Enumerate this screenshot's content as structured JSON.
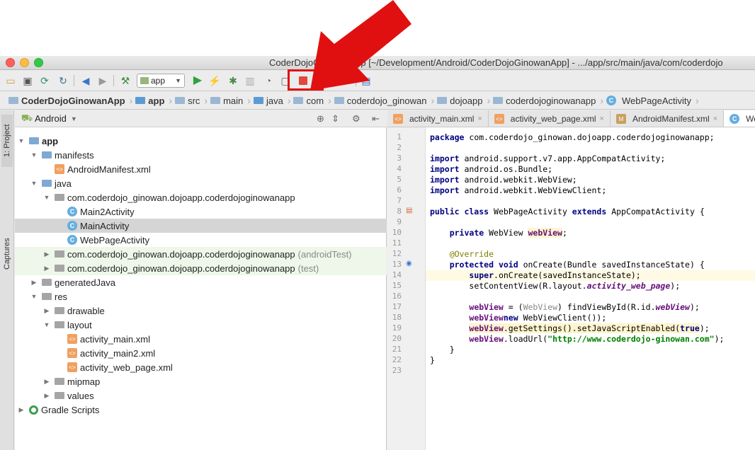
{
  "window": {
    "title": "CoderDojoGinowanApp [~/Development/Android/CoderDojoGinowanApp] - .../app/src/main/java/com/coderdojo"
  },
  "toolbar": {
    "run_config": "app",
    "icons": [
      "open-icon",
      "save-icon",
      "sync-icon",
      "refresh-icon",
      "back-icon",
      "forward-icon",
      "build-icon",
      "run-icon",
      "instant-run-icon",
      "debug-icon",
      "attach-icon",
      "profile-icon",
      "apply-icon",
      "stop-icon",
      "sdk-icon",
      "download-icon",
      "device-icon"
    ],
    "highlight_color": "#e01010"
  },
  "breadcrumb": [
    "CoderDojoGinowanApp",
    "app",
    "src",
    "main",
    "java",
    "com",
    "coderdojo_ginowan",
    "dojoapp",
    "coderdojoginowanapp",
    "WebPageActivity"
  ],
  "side_tabs": {
    "project": "1: Project",
    "captures": "Captures"
  },
  "project_panel": {
    "view_mode": "Android",
    "tree": [
      {
        "label": "app",
        "bold": true
      },
      {
        "label": "manifests"
      },
      {
        "label": "AndroidManifest.xml"
      },
      {
        "label": "java"
      },
      {
        "label": "com.coderdojo_ginowan.dojoapp.coderdojoginowanapp"
      },
      {
        "label": "Main2Activity"
      },
      {
        "label": "MainActivity"
      },
      {
        "label": "WebPageActivity"
      },
      {
        "label": "com.coderdojo_ginowan.dojoapp.coderdojoginowanapp",
        "suffix": "(androidTest)"
      },
      {
        "label": "com.coderdojo_ginowan.dojoapp.coderdojoginowanapp",
        "suffix": "(test)"
      },
      {
        "label": "generatedJava"
      },
      {
        "label": "res"
      },
      {
        "label": "drawable"
      },
      {
        "label": "layout"
      },
      {
        "label": "activity_main.xml"
      },
      {
        "label": "activity_main2.xml"
      },
      {
        "label": "activity_web_page.xml"
      },
      {
        "label": "mipmap"
      },
      {
        "label": "values"
      },
      {
        "label": "Gradle Scripts"
      }
    ]
  },
  "editor": {
    "tabs": [
      "activity_main.xml",
      "activity_web_page.xml",
      "AndroidManifest.xml",
      "WebP"
    ],
    "code": {
      "l1a": "package",
      "l1b": " com.coderdojo_ginowan.dojoapp.coderdojoginowanapp;",
      "imp": "import",
      "l3b": " android.support.v7.app.AppCompatActivity;",
      "l4b": " android.os.Bundle;",
      "l5b": " android.webkit.WebView;",
      "l6b": " android.webkit.WebViewClient;",
      "l8a": "public class",
      "l8b": " WebPageActivity ",
      "l8c": "extends",
      "l8d": " AppCompatActivity {",
      "l10a": "private",
      "l10b": " WebView ",
      "l10c": "webView",
      ";": ";",
      "l12": "@Override",
      "l13a": "protected void",
      "l13b": " onCreate(Bundle savedInstanceState) {",
      "l14a": "super",
      "l14b": ".onCreate(savedInstanceState);",
      "l15a": "setContentView(R.layout.",
      "l15b": "activity_web_page",
      "l15c": ");",
      "l17a": "webView",
      "l17b": " = (",
      "l17c": "WebView",
      "l17d": ") findViewById(R.id.",
      "l17e": "webView",
      "l17f": ");",
      "l18a": "webView",
      ".setWebViewClient(": ".setWebViewClient(",
      "l18b": "new",
      "l18c": " WebViewClient());",
      "l19a": "webView",
      "l19b": ".getSettings().setJavaScriptEnabled(",
      "l19c": "true",
      "l19d": ");",
      "l20a": "webView",
      "l20b": ".loadUrl(",
      "l20c": "\"http://www.coderdojo-ginowan.com\"",
      "l20d": ");",
      "l21": "}",
      "l22": "}"
    },
    "line_numbers": [
      "1",
      "2",
      "3",
      "4",
      "5",
      "6",
      "7",
      "8",
      "9",
      "10",
      "11",
      "12",
      "13",
      "14",
      "15",
      "16",
      "17",
      "18",
      "19",
      "20",
      "21",
      "22",
      "23"
    ]
  }
}
